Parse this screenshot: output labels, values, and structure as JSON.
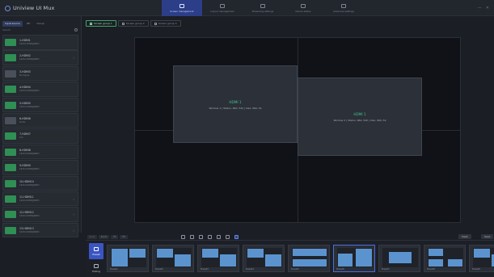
{
  "app": {
    "title": "Uniview UI Mux"
  },
  "topnav": [
    {
      "label": "Screen management",
      "active": true
    },
    {
      "label": "Layout management",
      "active": false
    },
    {
      "label": "Streaming settings",
      "active": false
    },
    {
      "label": "Device status",
      "active": false
    },
    {
      "label": "Advanced settings",
      "active": false
    }
  ],
  "window_controls": {
    "minimize": "—",
    "close": "✕"
  },
  "sidebar": {
    "tabs": [
      "Input source",
      "IPC",
      "Group"
    ],
    "search_placeholder": "Search",
    "sources": [
      {
        "name": "1-HDMI1",
        "desc": "1920×1080@60Hz",
        "online": true,
        "arrow": ""
      },
      {
        "name": "2-HDMI2",
        "desc": "1920×1080@60Hz",
        "online": true,
        "arrow": "›"
      },
      {
        "name": "3-HDMI3",
        "desc": "No Signal",
        "online": false,
        "arrow": ""
      },
      {
        "name": "4-HDMI4",
        "desc": "1920×1080@60Hz",
        "online": true,
        "arrow": ""
      },
      {
        "name": "5-HDMI5",
        "desc": "1920×1080@60Hz",
        "online": true,
        "arrow": ""
      },
      {
        "name": "6-HDMI6",
        "desc": "DVI-D",
        "online": false,
        "arrow": ""
      },
      {
        "name": "7-HDMI7",
        "desc": "1x1",
        "online": true,
        "arrow": ""
      },
      {
        "name": "8-HDMI8",
        "desc": "1920×1080@60Hz",
        "online": true,
        "arrow": ""
      },
      {
        "name": "9-HDMI9",
        "desc": "1920×1080@60Hz",
        "online": true,
        "arrow": ""
      },
      {
        "name": "10-HDMI10",
        "desc": "1920×1080@60Hz",
        "online": true,
        "arrow": ""
      },
      {
        "name": "11-HDMI11",
        "desc": "1920×1080@60Hz",
        "online": true,
        "arrow": "›"
      },
      {
        "name": "12-HDMI12",
        "desc": "1920×1080@60Hz",
        "online": true,
        "arrow": "›"
      },
      {
        "name": "13-HDMI13",
        "desc": "1920×1080@60Hz",
        "online": true,
        "arrow": "›"
      }
    ]
  },
  "main_tabs": [
    {
      "label": "Screen group 1",
      "active": true
    },
    {
      "label": "Screen group 2",
      "active": false
    },
    {
      "label": "Screen group 3",
      "active": false
    }
  ],
  "windows": [
    {
      "title": "HDMI 1",
      "info": "Window 1 | Status: 960, 540 | Size: 960, 54"
    },
    {
      "title": "HDMI 1",
      "info": "Window 2 | Status: 960, 540 | Size: 960, 54"
    }
  ],
  "toolbar": {
    "chips": [
      "1 / 1",
      "Zoom",
      "Fit",
      "Fill"
    ],
    "buttons": [
      "Clear",
      "Save"
    ]
  },
  "modes": [
    {
      "label": "Preset",
      "active": true
    },
    {
      "label": "Polling",
      "active": false
    }
  ],
  "presets": [
    {
      "label": "Preset1"
    },
    {
      "label": "Preset2"
    },
    {
      "label": "Preset3"
    },
    {
      "label": "Preset4"
    },
    {
      "label": "Preset5"
    },
    {
      "label": "Preset6"
    },
    {
      "label": "Preset7"
    },
    {
      "label": "Preset8"
    },
    {
      "label": "Preset9"
    }
  ],
  "colors": {
    "accent": "#3a55c2",
    "online": "#2f8f55",
    "window_title": "#3fc28c",
    "preset_block": "#5b93cf"
  }
}
